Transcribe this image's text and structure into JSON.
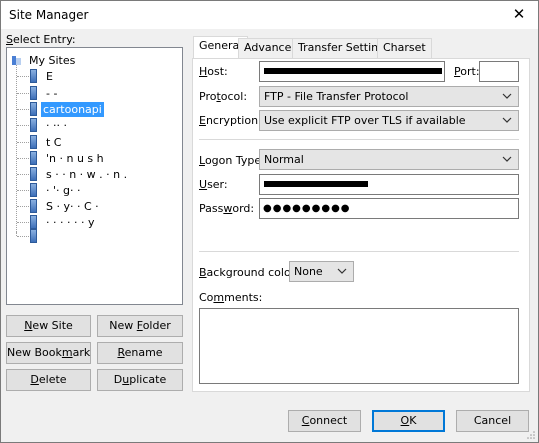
{
  "window": {
    "title": "Site Manager"
  },
  "select_entry_label": "Select Entry:",
  "tree": {
    "root_label": "My Sites",
    "items": [
      {
        "label": "E"
      },
      {
        "label": "- -"
      },
      {
        "label": "cartoonapi",
        "selected": true
      },
      {
        "label": "· ·· ·"
      },
      {
        "label": "t C"
      },
      {
        "label": "'n ·  n  u  s  h"
      },
      {
        "label": "s  · · n  · w  . · n  ."
      },
      {
        "label": "· '· g· ·"
      },
      {
        "label": "S  · y· · C  ·"
      },
      {
        "label": "· · · · · · y"
      },
      {
        "label": ""
      }
    ]
  },
  "buttons": {
    "new_site": "New Site",
    "new_folder": "New Folder",
    "new_bookmark": "New Bookmark",
    "rename": "Rename",
    "delete": "Delete",
    "duplicate": "Duplicate",
    "connect": "Connect",
    "ok": "OK",
    "cancel": "Cancel"
  },
  "tabs": [
    "General",
    "Advanced",
    "Transfer Settings",
    "Charset"
  ],
  "general": {
    "host_label": "Host:",
    "host_value": "",
    "port_label": "Port:",
    "port_value": "",
    "protocol_label": "Protocol:",
    "protocol_value": "FTP - File Transfer Protocol",
    "encryption_label": "Encryption:",
    "encryption_value": "Use explicit FTP over TLS if available",
    "logon_type_label": "Logon Type:",
    "logon_type_value": "Normal",
    "user_label": "User:",
    "user_value": "",
    "password_label": "Password:",
    "password_value": "●●●●●●●●●",
    "background_color_label": "Background color:",
    "background_color_value": "None",
    "comments_label": "Comments:",
    "comments_value": ""
  },
  "colors": {
    "selection": "#3399ff",
    "default_button_border": "#0078d7"
  }
}
